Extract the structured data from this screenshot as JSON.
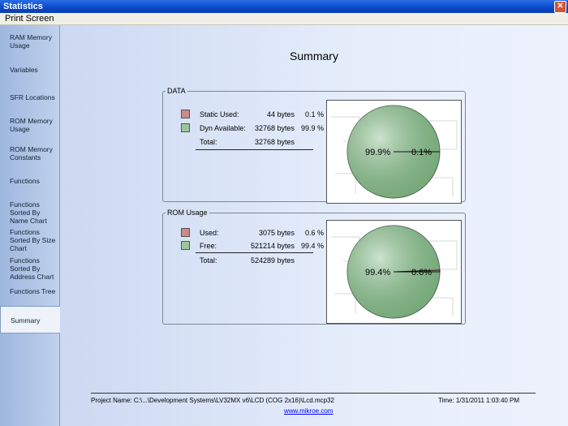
{
  "window": {
    "title": "Statistics",
    "close_glyph": "✕"
  },
  "menu": {
    "print_screen": "Print Screen"
  },
  "sidebar": {
    "items": [
      {
        "label": "RAM Memory Usage"
      },
      {
        "label": "Variables"
      },
      {
        "label": "SFR Locations"
      },
      {
        "label": "ROM Memory Usage"
      },
      {
        "label": "ROM Memory Constants"
      },
      {
        "label": "Functions"
      },
      {
        "label": "Functions Sorted By Name Chart"
      },
      {
        "label": "Functions Sorted By Size Chart"
      },
      {
        "label": "Functions Sorted By Address Chart"
      },
      {
        "label": "Functions Tree"
      },
      {
        "label": "Summary"
      }
    ],
    "selected": "Summary"
  },
  "main": {
    "heading": "Summary",
    "data_group": {
      "legend": "DATA",
      "rows": [
        {
          "label": "Static Used:",
          "value": "44 bytes",
          "percent": "0.1 %",
          "color": "#c98b8b"
        },
        {
          "label": "Dyn Available:",
          "value": "32768 bytes",
          "percent": "99.9 %",
          "color": "#9cc59c"
        }
      ],
      "total_label": "Total:",
      "total_value": "32768 bytes",
      "pie": {
        "big_label": "99.9%",
        "small_label": "0.1%"
      }
    },
    "rom_group": {
      "legend": "ROM Usage",
      "rows": [
        {
          "label": "Used:",
          "value": "3075 bytes",
          "percent": "0.6 %",
          "color": "#c98b8b"
        },
        {
          "label": "Free:",
          "value": "521214 bytes",
          "percent": "99.4 %",
          "color": "#9cc59c"
        }
      ],
      "total_label": "Total:",
      "total_value": "524289 bytes",
      "pie": {
        "big_label": "99.4%",
        "small_label": "0.6%"
      }
    },
    "footer": {
      "project": "Project Name: C:\\...\\Development Systems\\LV32MX v6\\LCD (COG 2x16)\\Lcd.mcp32",
      "time": "Time: 1/31/2011 1:03:40 PM",
      "link": "www.mikroe.com"
    }
  },
  "colors": {
    "title_bar": "#0a48c9",
    "used": "#c98b8b",
    "free": "#9cc59c",
    "pie_fill": "#8fbf92"
  }
}
